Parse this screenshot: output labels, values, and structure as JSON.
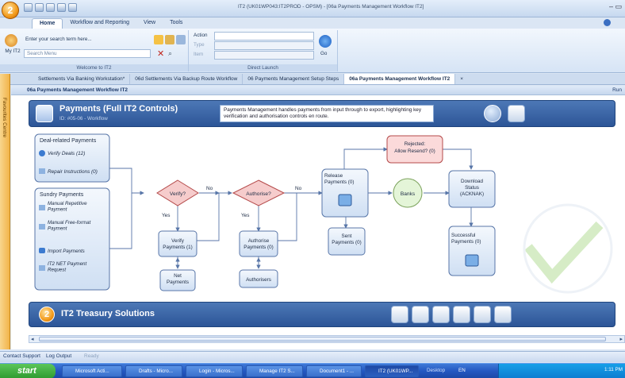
{
  "window": {
    "title": "IT2 (UK01WP043:IT2PROD - OPSM) - [06a Payments Management Workflow IT2]",
    "orb_label": "2"
  },
  "ribbon_tabs": [
    "Home",
    "Workflow and Reporting",
    "View",
    "Tools"
  ],
  "ribbon": {
    "search_label": "Enter your search term here...",
    "my_label": "My IT2",
    "search_menu_placeholder": "Search Menu",
    "welcome_label": "Welcome to IT2",
    "action_label": "Action",
    "type_label": "Type",
    "item_label": "Item",
    "go_label": "Go",
    "direct_launch_label": "Direct Launch"
  },
  "doc_tabs": [
    "Settlements Via Banking Workstation*",
    "06d Settlements Via Backup Route Workflow",
    "06 Payments Management Setup Steps",
    "06a Payments Management Workflow IT2"
  ],
  "sidebar": {
    "label": "Favourites Centre"
  },
  "page": {
    "header_title": "06a Payments Management Workflow IT2",
    "run_label": "Run"
  },
  "banner": {
    "title": "Payments (Full IT2 Controls)",
    "subtitle": "ID: #05-06 - Workflow",
    "description": "Payments Management handles payments from input through to export, highlighting key verification and authorisation controls en route."
  },
  "flow": {
    "deal_box": {
      "title": "Deal-related Payments",
      "items": [
        "Verify Deals (12)",
        "Repair Instructions (0)"
      ]
    },
    "sundry_box": {
      "title": "Sundry Payments",
      "items": [
        "Manual Repetitive Payment",
        "Manual Free-format Payment",
        "Import Payments",
        "IT2 NET Payment Request"
      ]
    },
    "verify_decision": "Verify?",
    "authorise_decision": "Authorise?",
    "yes_label": "Yes",
    "no_label": "No",
    "verify_payments": "Verify Payments (1)",
    "net_payments": "Net Payments",
    "authorise_payments": "Authorise Payments (0)",
    "authorisers": "Authorisers",
    "release_payments": "Release Payments (0)",
    "sent_payments": "Sent Payments (0)",
    "banks": "Banks",
    "rejected": "Rejected: Allow Resend? (0)",
    "download_status": "Download Status (ACKNAK)",
    "successful_payments": "Successful Payments (0)"
  },
  "footer": {
    "title": "IT2 Treasury Solutions",
    "orb_label": "2"
  },
  "status_bar": [
    "Contact Support",
    "Log Output",
    "Ready"
  ],
  "taskbar": {
    "start_label": "start",
    "items": [
      "Microsoft Acti...",
      "Drafts - Micro...",
      "Login - Micros...",
      "Manage IT2 S...",
      "Document1 - ...",
      "IT2 (UK01WP..."
    ],
    "desktop_label": "Desktop",
    "lang": "EN",
    "clock": "1:11 PM"
  },
  "colors": {
    "ribbon_blue": "#2c5597",
    "decision_red": "#f4c6c6",
    "process_blue": "#dce8f7",
    "banks_green": "#e4f5d8",
    "orange_orb": "#f29a1a"
  }
}
